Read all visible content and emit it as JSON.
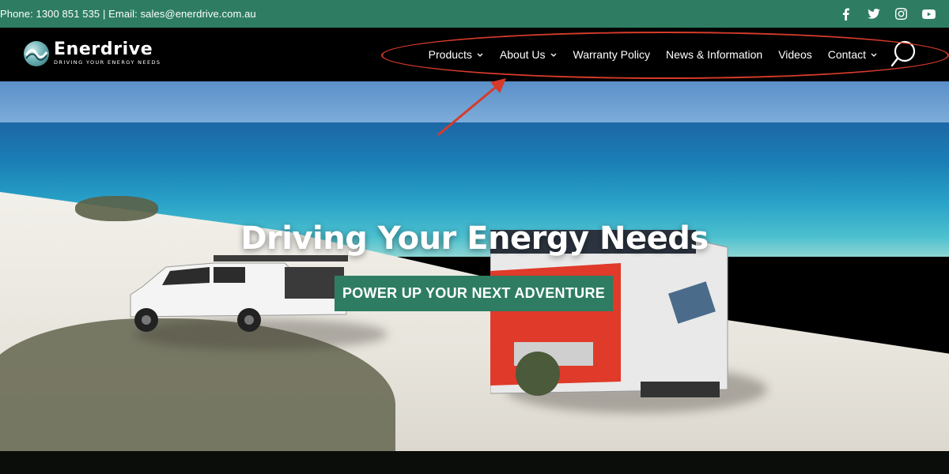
{
  "topbar": {
    "contact_text": "Phone: 1300 851 535 | Email: sales@enerdrive.com.au",
    "social": [
      "facebook",
      "twitter",
      "instagram",
      "youtube"
    ],
    "background": "#2e7d62"
  },
  "header": {
    "logo": {
      "brand": "Enerdrive",
      "tagline": "DRIVING YOUR ENERGY NEEDS"
    },
    "nav": [
      {
        "label": "Products",
        "has_dropdown": true
      },
      {
        "label": "About Us",
        "has_dropdown": true
      },
      {
        "label": "Warranty Policy",
        "has_dropdown": false
      },
      {
        "label": "News & Information",
        "has_dropdown": false
      },
      {
        "label": "Videos",
        "has_dropdown": false
      },
      {
        "label": "Contact",
        "has_dropdown": true
      }
    ],
    "search_icon": "search-icon"
  },
  "annotation": {
    "color": "#d63b2a",
    "shape": "ellipse-with-arrow",
    "target": "main-navigation"
  },
  "hero": {
    "title": "Driving Your Energy Needs",
    "cta_label": "POWER UP YOUR NEXT ADVENTURE",
    "cta_color": "#2e7d62"
  }
}
